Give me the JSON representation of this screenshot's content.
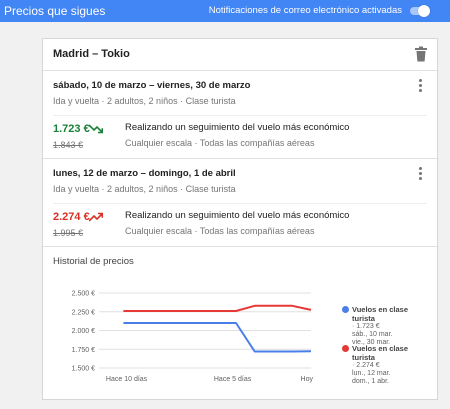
{
  "topbar": {
    "title": "Precios que sigues",
    "notifications_label": "Notificaciones de correo electrónico activadas",
    "toggle_on": true
  },
  "card": {
    "route": "Madrid – Tokio",
    "trips": [
      {
        "dates": "sábado, 10 de marzo – viernes, 30 de marzo",
        "meta": "Ida y vuelta · 2 adultos, 2 niños · Clase turista",
        "price": "1.723 €",
        "old_price": "1.843 €",
        "trend": "down",
        "price_color": "#188038",
        "tracking_title": "Realizando un seguimiento del vuelo más económico",
        "tracking_sub": "Cualquier escala · Todas las compañías aéreas"
      },
      {
        "dates": "lunes, 12 de marzo – domingo, 1 de abril",
        "meta": "Ida y vuelta · 2 adultos, 2 niños · Clase turista",
        "price": "2.274 €",
        "old_price": "1.995 €",
        "trend": "up",
        "price_color": "#d93025",
        "tracking_title": "Realizando un seguimiento del vuelo más económico",
        "tracking_sub": "Cualquier escala · Todas las compañías aéreas"
      }
    ]
  },
  "history": {
    "title": "Historial de precios",
    "legend": [
      {
        "name": "Vuelos en clase turista",
        "detail": "· 1.723 €\nsáb., 10 mar.\nvie., 30 mar.",
        "color": "#4a7fe8"
      },
      {
        "name": "Vuelos en clase turista",
        "detail": "· 2.274 €\nlun., 12 mar.\ndom., 1 abr.",
        "color": "#e53935"
      }
    ]
  },
  "chart_data": {
    "type": "line",
    "title": "Historial de precios",
    "x_ticks": [
      "Hace 10 días",
      "Hace 5 días",
      "Hoy"
    ],
    "x": [
      0,
      1,
      2,
      3,
      4,
      5,
      6,
      7,
      8,
      9,
      10
    ],
    "y_ticks": [
      "1.500 €",
      "1.750 €",
      "2.000 €",
      "2.250 €",
      "2.500 €"
    ],
    "y_tick_values": [
      1500,
      1750,
      2000,
      2250,
      2500
    ],
    "ylim": [
      1500,
      2500
    ],
    "grid": true,
    "legend_position": "right",
    "series": [
      {
        "name": "Vuelos en clase turista",
        "color": "#4a7fe8",
        "values": [
          2100,
          2100,
          2100,
          2100,
          2100,
          2100,
          2100,
          1720,
          1720,
          1720,
          1723
        ]
      },
      {
        "name": "Vuelos en clase turista",
        "color": "#e53935",
        "values": [
          2260,
          2260,
          2260,
          2260,
          2260,
          2260,
          2260,
          2330,
          2330,
          2330,
          2274
        ]
      }
    ]
  }
}
